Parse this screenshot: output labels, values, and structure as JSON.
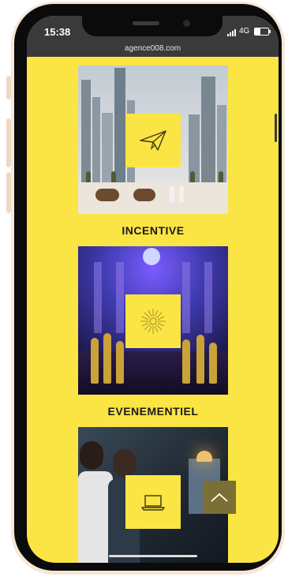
{
  "status": {
    "time": "15:38",
    "network": "4G",
    "battery_level": 0.4
  },
  "browser": {
    "url": "agence008.com"
  },
  "sections": [
    {
      "title": "INCENTIVE",
      "icon": "paper-plane-icon",
      "photo": "Dubai skyline with camels on beach"
    },
    {
      "title": "EVENEMENTIEL",
      "icon": "sunburst-icon",
      "photo": "Dancers in front of illuminated palace"
    },
    {
      "title": "",
      "icon": "laptop-icon",
      "photo": "People working at computers"
    }
  ],
  "back_to_top": {
    "icon": "chevron-up-icon"
  },
  "colors": {
    "accent": "#fbe544",
    "button": "#7c6f35",
    "text": "#1b1b1b"
  }
}
